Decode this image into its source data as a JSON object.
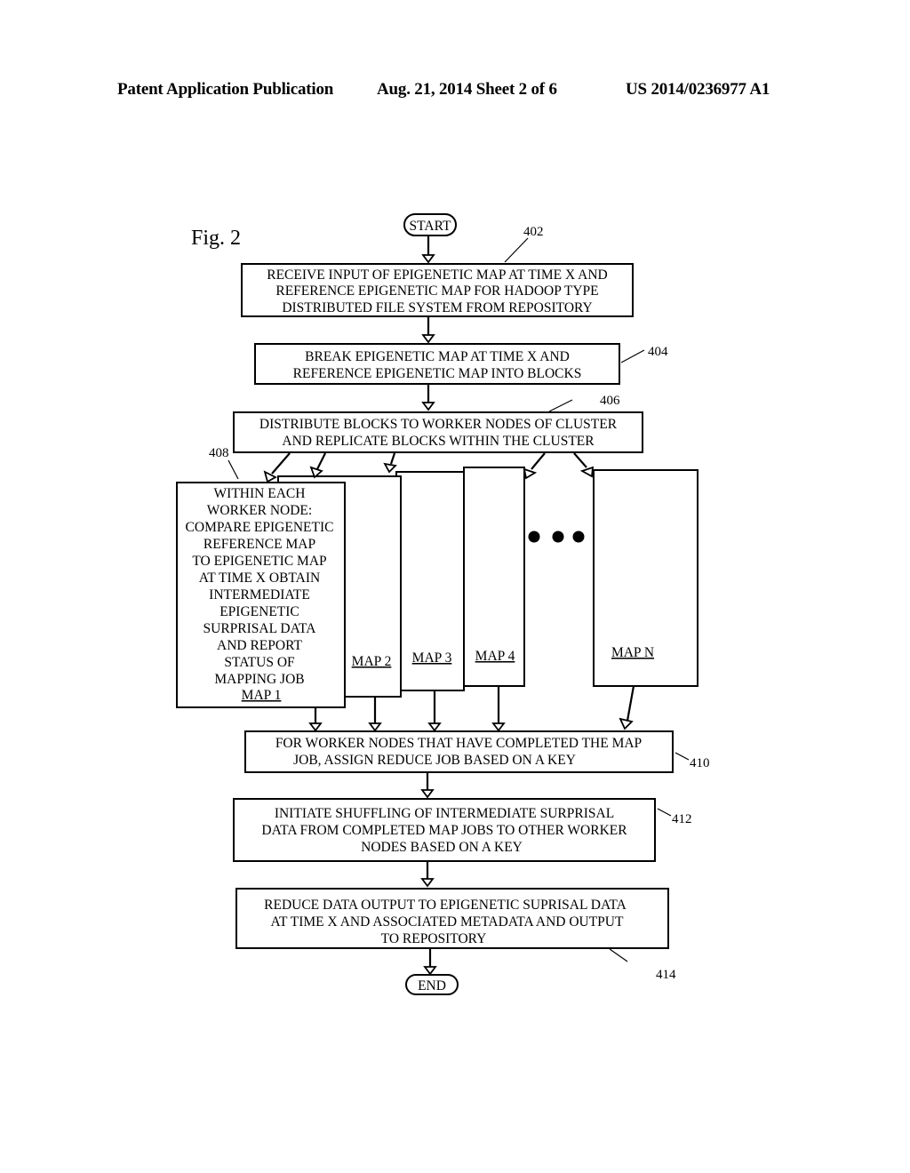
{
  "header": {
    "publication": "Patent Application Publication",
    "date_sheet": "Aug. 21, 2014  Sheet 2 of 6",
    "number": "US 2014/0236977 A1"
  },
  "figure": {
    "label": "Fig. 2",
    "start": "START",
    "end": "END",
    "steps": [
      {
        "ref": "402",
        "lines": [
          "RECEIVE INPUT OF EPIGENETIC MAP AT TIME X AND",
          "REFERENCE EPIGENETIC MAP FOR HADOOP TYPE",
          "DISTRIBUTED FILE SYSTEM FROM REPOSITORY"
        ]
      },
      {
        "ref": "404",
        "lines": [
          "BREAK EPIGENETIC MAP AT TIME X AND",
          "REFERENCE EPIGENETIC MAP INTO BLOCKS"
        ]
      },
      {
        "ref": "406",
        "lines": [
          "DISTRIBUTE BLOCKS TO WORKER NODES OF CLUSTER",
          "AND REPLICATE BLOCKS WITHIN THE CLUSTER"
        ]
      },
      {
        "ref": "408",
        "lines": [
          "WITHIN EACH",
          "WORKER NODE:",
          "COMPARE EPIGENETIC",
          "REFERENCE MAP",
          "TO EPIGENETIC MAP",
          "AT TIME X OBTAIN",
          "INTERMEDIATE",
          "EPIGENETIC",
          "SURPRISAL DATA",
          "AND REPORT",
          "STATUS OF",
          "MAPPING JOB"
        ]
      },
      {
        "ref": "410",
        "lines": [
          "FOR WORKER NODES THAT HAVE COMPLETED THE MAP",
          "JOB, ASSIGN REDUCE JOB BASED ON A KEY"
        ]
      },
      {
        "ref": "412",
        "lines": [
          "INITIATE SHUFFLING OF INTERMEDIATE SURPRISAL",
          "DATA FROM COMPLETED MAP JOBS TO OTHER WORKER",
          "NODES BASED ON A KEY"
        ]
      },
      {
        "ref": "414",
        "lines": [
          "REDUCE DATA OUTPUT TO EPIGENETIC SUPRISAL DATA",
          "AT TIME X AND ASSOCIATED METADATA AND OUTPUT",
          "TO REPOSITORY"
        ]
      }
    ],
    "map_labels": [
      "MAP 1",
      "MAP 2",
      "MAP 3",
      "MAP 4",
      "MAP N"
    ],
    "ellipsis": "• • •"
  }
}
